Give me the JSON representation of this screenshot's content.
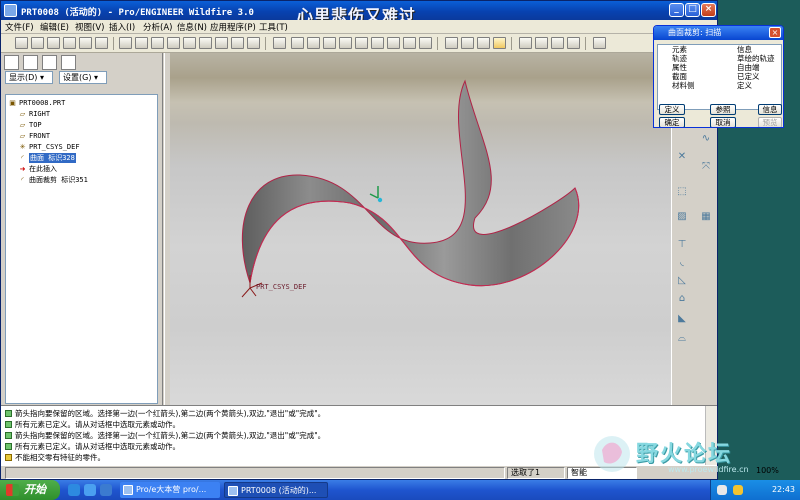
{
  "window": {
    "title": "PRT0008 (活动的) - Pro/ENGINEER Wildfire 3.0",
    "overlay_text": "心里悲伤又难过"
  },
  "menu": [
    "文件(F)",
    "编辑(E)",
    "视图(V)",
    "插入(I)",
    "分析(A)",
    "信息(N)",
    "应用程序(P)",
    "工具(T)"
  ],
  "panel": {
    "display_label": "显示(D)",
    "settings_label": "设置(G)"
  },
  "tree": {
    "root": "PRT0008.PRT",
    "nodes": [
      "RIGHT",
      "TOP",
      "FRONT",
      "PRT_CSYS_DEF",
      "曲面 标识328",
      "在此插入",
      "曲面裁剪 标识351"
    ]
  },
  "viewport": {
    "csys_label": "PRT_CSYS_DEF"
  },
  "dialog": {
    "title": "曲面裁剪: 扫描",
    "col_element": "元素",
    "col_info": "信息",
    "rows": [
      {
        "element": "轨迹",
        "info": "草绘的轨迹"
      },
      {
        "element": "属性",
        "info": "自由端"
      },
      {
        "element": "截面",
        "info": "已定义"
      },
      {
        "element": "材料侧",
        "info": "定义"
      }
    ],
    "buttons": [
      "定义",
      "参照",
      "信息",
      "确定",
      "取消",
      "预览"
    ]
  },
  "messages": [
    "箭头指向要保留的区域。选择第一边(一个红箭头),第二边(两个黄箭头),双边,\"退出\"或\"完成\"。",
    "所有元素已定义。请从对话框中选取元素或动作。",
    "箭头指向要保留的区域。选择第一边(一个红箭头),第二边(两个黄箭头),双边,\"退出\"或\"完成\"。",
    "所有元素已定义。请从对话框中选取元素或动作。",
    "不能相交零有特征的零件。"
  ],
  "status": {
    "selected": "选取了1",
    "filter": "智能"
  },
  "taskbar": {
    "start": "开始",
    "tasks": [
      "Pro/e大本营 pro/...",
      "PRT0008 (活动的)..."
    ],
    "zoom": "100%",
    "clock": "22:43"
  },
  "watermark": {
    "text": "野火论坛",
    "url": "www.proewildfire.cn"
  }
}
